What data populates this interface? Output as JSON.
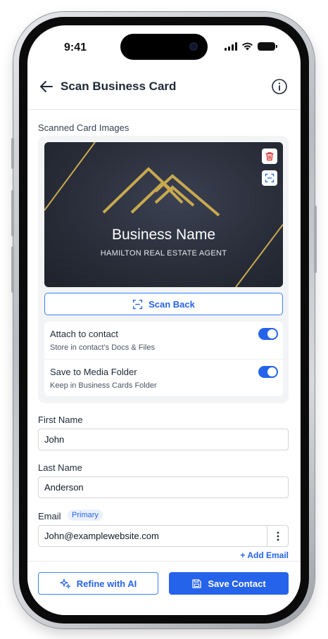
{
  "status_bar": {
    "time": "9:41"
  },
  "header": {
    "title": "Scan Business Card"
  },
  "scan_section": {
    "label": "Scanned Card Images",
    "card": {
      "business_name": "Business Name",
      "subtitle": "HAMILTON REAL ESTATE AGENT"
    },
    "scan_back_label": "Scan Back"
  },
  "options": [
    {
      "title": "Attach to contact",
      "description": "Store in contact’s Docs & Files",
      "enabled": true
    },
    {
      "title": "Save to Media Folder",
      "description": "Keep in Business Cards Folder",
      "enabled": true
    }
  ],
  "form": {
    "first_name": {
      "label": "First Name",
      "value": "John"
    },
    "last_name": {
      "label": "Last Name",
      "value": "Anderson"
    },
    "email": {
      "label": "Email",
      "badge": "Primary",
      "value": "John@examplewebsite.com"
    },
    "add_email_label": "+ Add Email"
  },
  "footer": {
    "refine_label": "Refine with AI",
    "save_label": "Save Contact"
  },
  "colors": {
    "accent": "#2563eb",
    "delete": "#dc2626",
    "gold": "#c9a94f",
    "card_bg": "#2a2e3a"
  }
}
